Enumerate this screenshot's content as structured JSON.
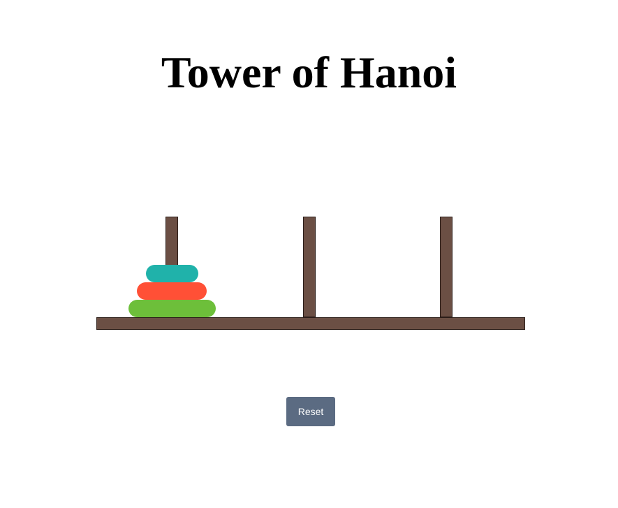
{
  "title": "Tower of Hanoi",
  "colors": {
    "wood": "#6b4f44",
    "button": "#5b6b82",
    "button_text": "#ffffff"
  },
  "pegs": [
    {
      "name": "peg-1",
      "disks": [
        3,
        2,
        1
      ]
    },
    {
      "name": "peg-2",
      "disks": []
    },
    {
      "name": "peg-3",
      "disks": []
    }
  ],
  "disks": [
    {
      "size": 1,
      "color": "#20b2aa"
    },
    {
      "size": 2,
      "color": "#ff5036"
    },
    {
      "size": 3,
      "color": "#6dbf3a"
    }
  ],
  "controls": {
    "reset_label": "Reset"
  }
}
